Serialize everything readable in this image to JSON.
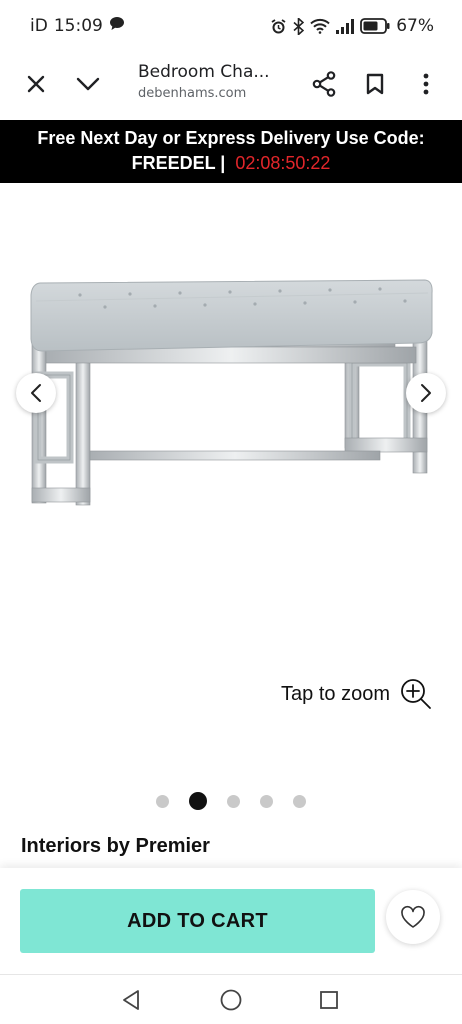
{
  "status_bar": {
    "carrier": "iD",
    "time": "15:09",
    "battery": "67%"
  },
  "browser": {
    "title": "Bedroom Cha...",
    "domain": "debenhams.com"
  },
  "promo": {
    "line1": "Free Next Day or Express Delivery Use Code:",
    "code": "FREEDEL |",
    "timer": "02:08:50:22"
  },
  "gallery": {
    "zoom_label": "Tap to zoom",
    "image_count": 5,
    "active_image": 2
  },
  "product": {
    "brand": "Interiors by Premier"
  },
  "cart": {
    "add_label": "ADD TO CART"
  },
  "colors": {
    "accent": "#7fe6d4",
    "promo_bg": "#000000",
    "timer": "#e3262b"
  }
}
